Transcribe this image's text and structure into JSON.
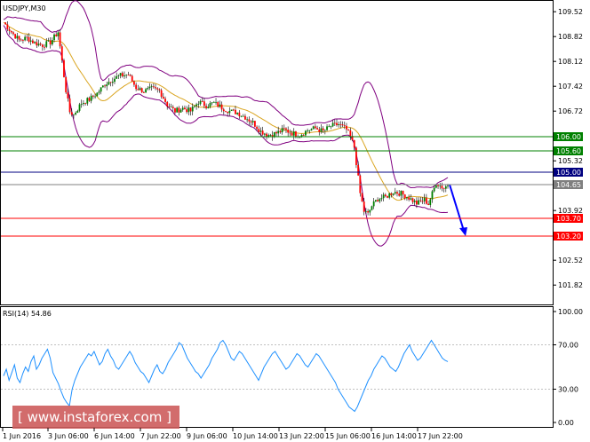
{
  "chart_data": [
    {
      "type": "candlestick",
      "title": "USDJPY,M30",
      "x_tick_labels": [
        "1 Jun 2016",
        "3 Jun 06:00",
        "6 Jun 14:00",
        "7 Jun 22:00",
        "9 Jun 06:00",
        "10 Jun 14:00",
        "13 Jun 22:00",
        "15 Jun 06:00",
        "16 Jun 14:00",
        "17 Jun 22:00"
      ],
      "y_tick_labels": [
        "109.52",
        "108.82",
        "108.12",
        "107.42",
        "106.72",
        "106.02",
        "105.32",
        "104.62",
        "103.92",
        "103.22",
        "102.52",
        "101.82"
      ],
      "ylim": [
        101.3,
        109.8
      ],
      "current_price": 104.65,
      "price_levels": [
        {
          "value": 106.0,
          "label": "106.00",
          "color": "#008000"
        },
        {
          "value": 105.6,
          "label": "105.60",
          "color": "#008000"
        },
        {
          "value": 105.0,
          "label": "105.00",
          "color": "#000080"
        },
        {
          "value": 104.65,
          "label": "104.65",
          "color": "#808080"
        },
        {
          "value": 103.7,
          "label": "103.70",
          "color": "#ff0000"
        },
        {
          "value": 103.2,
          "label": "103.20",
          "color": "#ff0000"
        }
      ],
      "close_path": [
        [
          0,
          109.22
        ],
        [
          4,
          108.95
        ],
        [
          8,
          108.72
        ],
        [
          12,
          108.78
        ],
        [
          16,
          108.64
        ],
        [
          20,
          108.58
        ],
        [
          24,
          108.66
        ],
        [
          28,
          108.95
        ],
        [
          32,
          107.3
        ],
        [
          34,
          106.7
        ],
        [
          36,
          106.62
        ],
        [
          40,
          106.95
        ],
        [
          44,
          107.05
        ],
        [
          48,
          107.22
        ],
        [
          52,
          107.48
        ],
        [
          56,
          107.62
        ],
        [
          60,
          107.72
        ],
        [
          64,
          107.75
        ],
        [
          68,
          107.38
        ],
        [
          72,
          107.28
        ],
        [
          76,
          107.35
        ],
        [
          80,
          107.3
        ],
        [
          84,
          106.9
        ],
        [
          88,
          106.72
        ],
        [
          92,
          106.8
        ],
        [
          96,
          106.72
        ],
        [
          100,
          106.98
        ],
        [
          104,
          106.88
        ],
        [
          108,
          106.95
        ],
        [
          112,
          106.82
        ],
        [
          116,
          106.72
        ],
        [
          120,
          106.68
        ],
        [
          124,
          106.55
        ],
        [
          128,
          106.4
        ],
        [
          132,
          106.15
        ],
        [
          136,
          106.05
        ],
        [
          140,
          106.1
        ],
        [
          144,
          106.2
        ],
        [
          148,
          106.1
        ],
        [
          152,
          106.05
        ],
        [
          156,
          106.18
        ],
        [
          160,
          106.24
        ],
        [
          164,
          106.15
        ],
        [
          168,
          106.3
        ],
        [
          172,
          106.35
        ],
        [
          176,
          106.2
        ],
        [
          178,
          106.0
        ],
        [
          180,
          105.7
        ],
        [
          183,
          104.4
        ],
        [
          185,
          103.9
        ],
        [
          187,
          103.82
        ],
        [
          189,
          104.05
        ],
        [
          192,
          104.25
        ],
        [
          196,
          104.3
        ],
        [
          200,
          104.45
        ],
        [
          204,
          104.4
        ],
        [
          208,
          104.28
        ],
        [
          212,
          104.12
        ],
        [
          216,
          104.22
        ],
        [
          218,
          104.1
        ],
        [
          220,
          104.4
        ],
        [
          222,
          104.7
        ],
        [
          224,
          104.62
        ],
        [
          226,
          104.55
        ],
        [
          228,
          104.65
        ]
      ],
      "forecast_arrow": {
        "from": 104.65,
        "to": 103.2,
        "color": "#0000ff"
      }
    },
    {
      "type": "line",
      "title": "RSI(14) 54.86",
      "y_tick_labels": [
        "100.00",
        "70.00",
        "30.00",
        "0.00"
      ],
      "ylim": [
        0,
        100
      ],
      "levels": [
        30,
        70
      ],
      "series": [
        {
          "color": "#1e90ff",
          "values": [
            42,
            48,
            38,
            45,
            52,
            40,
            36,
            44,
            50,
            46,
            55,
            60,
            48,
            52,
            58,
            62,
            66,
            58,
            45,
            40,
            35,
            28,
            22,
            18,
            15,
            30,
            38,
            44,
            50,
            54,
            58,
            62,
            60,
            64,
            58,
            52,
            55,
            62,
            66,
            60,
            56,
            50,
            48,
            52,
            56,
            60,
            64,
            60,
            54,
            50,
            46,
            44,
            40,
            36,
            42,
            48,
            52,
            46,
            44,
            48,
            54,
            58,
            62,
            66,
            72,
            70,
            64,
            58,
            54,
            50,
            46,
            44,
            40,
            44,
            48,
            52,
            58,
            62,
            66,
            72,
            74,
            70,
            64,
            58,
            56,
            60,
            64,
            62,
            58,
            54,
            50,
            46,
            42,
            38,
            44,
            50,
            54,
            58,
            62,
            64,
            60,
            56,
            52,
            48,
            50,
            54,
            58,
            62,
            60,
            56,
            52,
            50,
            54,
            58,
            62,
            60,
            56,
            52,
            48,
            44,
            40,
            36,
            30,
            26,
            22,
            18,
            14,
            12,
            10,
            14,
            20,
            26,
            32,
            38,
            42,
            48,
            52,
            56,
            60,
            58,
            54,
            50,
            48,
            46,
            50,
            56,
            62,
            66,
            70,
            64,
            60,
            56,
            58,
            62,
            66,
            70,
            74,
            70,
            66,
            62,
            58,
            56,
            54.86
          ]
        }
      ]
    }
  ],
  "watermark": "[ www.instaforex.com ]",
  "colors": {
    "bull": "#008000",
    "bear": "#ff0000",
    "bands": "#800080",
    "ma": "#daa520",
    "rsi": "#1e90ff"
  }
}
